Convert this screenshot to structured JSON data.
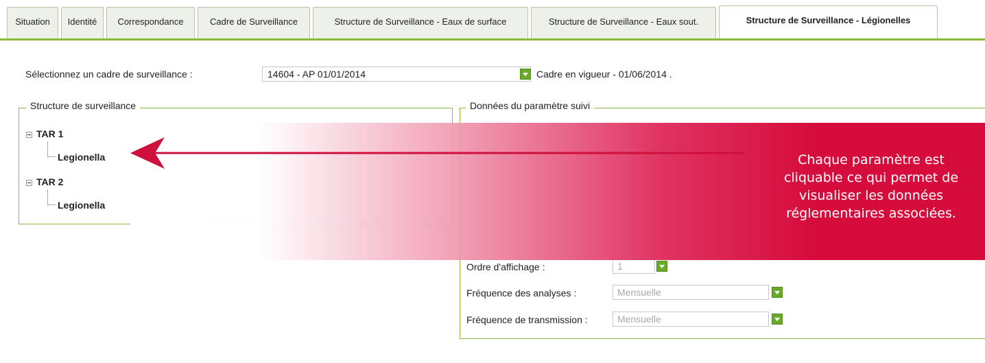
{
  "tabs": [
    {
      "label": "Situation",
      "active": false
    },
    {
      "label": "Identité",
      "active": false
    },
    {
      "label": "Correspondance",
      "active": false
    },
    {
      "label": "Cadre de Surveillance",
      "active": false
    },
    {
      "label": "Structure de Surveillance - Eaux de surface",
      "active": false
    },
    {
      "label": "Structure de Surveillance - Eaux sout.",
      "active": false
    },
    {
      "label": "Structure de Surveillance - Légionelles",
      "active": true
    }
  ],
  "cadre": {
    "label": "Sélectionnez un cadre de surveillance :",
    "selected": "14604 - AP 01/01/2014",
    "status": "Cadre en vigueur - 01/06/2014 ."
  },
  "structure": {
    "legend": "Structure de surveillance",
    "tree": [
      {
        "label": "TAR 1",
        "children": [
          "Legionella"
        ]
      },
      {
        "label": "TAR 2",
        "children": [
          "Legionella"
        ]
      }
    ]
  },
  "donnees": {
    "legend": "Données du paramètre suivi",
    "ordre_label": "Ordre d'affichage :",
    "ordre_value": "1",
    "freq_analyses_label": "Fréquence des analyses :",
    "freq_analyses_value": "Mensuelle",
    "freq_transmission_label": "Fréquence de transmission :",
    "freq_transmission_value": "Mensuelle"
  },
  "callout": {
    "text_lines": [
      "Chaque paramètre est",
      "cliquable ce qui permet de",
      "visualiser les  données",
      "réglementaires associées."
    ]
  },
  "colors": {
    "accent": "#8bbd3c",
    "dropdown": "#6aaa2a",
    "callout": "#d60c3c"
  }
}
